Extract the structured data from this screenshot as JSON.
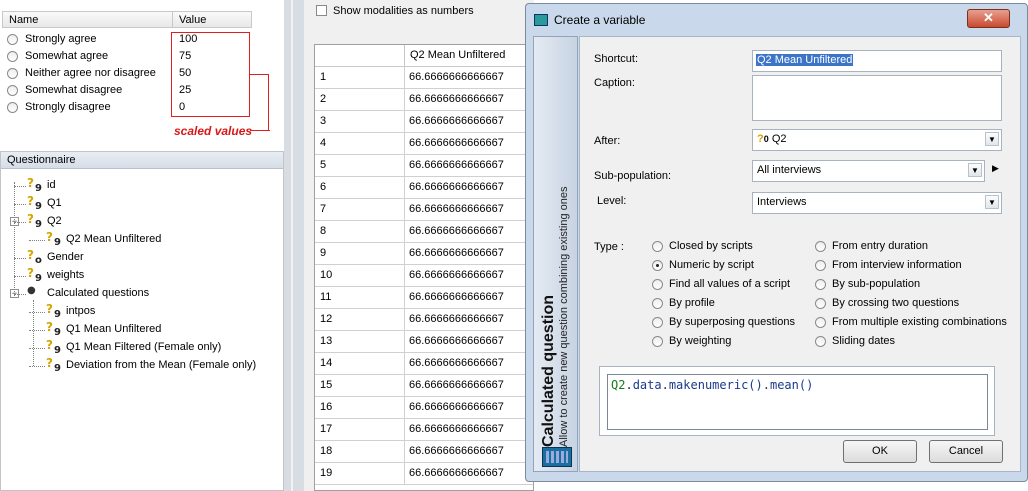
{
  "modalities": {
    "col_name": "Name",
    "col_value": "Value",
    "rows": [
      {
        "name": "Strongly agree",
        "value": "100"
      },
      {
        "name": "Somewhat agree",
        "value": "75"
      },
      {
        "name": "Neither agree nor disagree",
        "value": "50"
      },
      {
        "name": "Somewhat disagree",
        "value": "25"
      },
      {
        "name": "Strongly disagree",
        "value": "0"
      }
    ],
    "annotation": "scaled values",
    "annotation_color": "#e02020"
  },
  "questionnaire": {
    "title": "Questionnaire",
    "items": [
      {
        "label": "id",
        "icon": "question-numeric-icon"
      },
      {
        "label": "Q1",
        "icon": "question-numeric-icon"
      },
      {
        "label": "Q2",
        "icon": "question-numeric-icon"
      },
      {
        "label": "Q2 Mean Unfiltered",
        "icon": "question-numeric-icon"
      },
      {
        "label": "Gender",
        "icon": "question-closed-icon"
      },
      {
        "label": "weights",
        "icon": "question-numeric-icon"
      },
      {
        "label": "Calculated questions",
        "icon": "folder-icon"
      },
      {
        "label": "intpos",
        "icon": "question-numeric-icon"
      },
      {
        "label": "Q1 Mean Unfiltered",
        "icon": "question-numeric-icon"
      },
      {
        "label": "Q1 Mean Filtered (Female only)",
        "icon": "question-numeric-icon"
      },
      {
        "label": "Deviation from the Mean (Female only)",
        "icon": "question-numeric-icon"
      }
    ]
  },
  "middle": {
    "show_as_numbers": "Show modalities as numbers",
    "column_header": "Q2 Mean Unfiltered",
    "rows": [
      {
        "n": "1",
        "v": "66.6666666666667"
      },
      {
        "n": "2",
        "v": "66.6666666666667"
      },
      {
        "n": "3",
        "v": "66.6666666666667"
      },
      {
        "n": "4",
        "v": "66.6666666666667"
      },
      {
        "n": "5",
        "v": "66.6666666666667"
      },
      {
        "n": "6",
        "v": "66.6666666666667"
      },
      {
        "n": "7",
        "v": "66.6666666666667"
      },
      {
        "n": "8",
        "v": "66.6666666666667"
      },
      {
        "n": "9",
        "v": "66.6666666666667"
      },
      {
        "n": "10",
        "v": "66.6666666666667"
      },
      {
        "n": "11",
        "v": "66.6666666666667"
      },
      {
        "n": "12",
        "v": "66.6666666666667"
      },
      {
        "n": "13",
        "v": "66.6666666666667"
      },
      {
        "n": "14",
        "v": "66.6666666666667"
      },
      {
        "n": "15",
        "v": "66.6666666666667"
      },
      {
        "n": "16",
        "v": "66.6666666666667"
      },
      {
        "n": "17",
        "v": "66.6666666666667"
      },
      {
        "n": "18",
        "v": "66.6666666666667"
      },
      {
        "n": "19",
        "v": "66.6666666666667"
      }
    ]
  },
  "dialog": {
    "title": "Create a variable",
    "close": "✕",
    "side_title": "Calculated question",
    "side_subtitle": "Allow to create new question combining existing ones",
    "shortcut_label": "Shortcut:",
    "shortcut_value": "Q2 Mean Unfiltered",
    "caption_label": "Caption:",
    "after_label": "After:",
    "after_value": "Q2",
    "subpop_label": "Sub-population:",
    "subpop_value": "All interviews",
    "level_label": "Level:",
    "level_value": "Interviews",
    "type_label": "Type :",
    "types_left": [
      "Closed by scripts",
      "Numeric by script",
      "Find all values of a script",
      "By profile",
      "By superposing questions",
      "By weighting"
    ],
    "types_right": [
      "From entry duration",
      "From interview information",
      "By sub-population",
      "By crossing two questions",
      "From multiple existing combinations",
      "Sliding dates"
    ],
    "selected_type": "Numeric by script",
    "script": "Q2.data.makenumeric().mean()",
    "ok": "OK",
    "cancel": "Cancel"
  }
}
